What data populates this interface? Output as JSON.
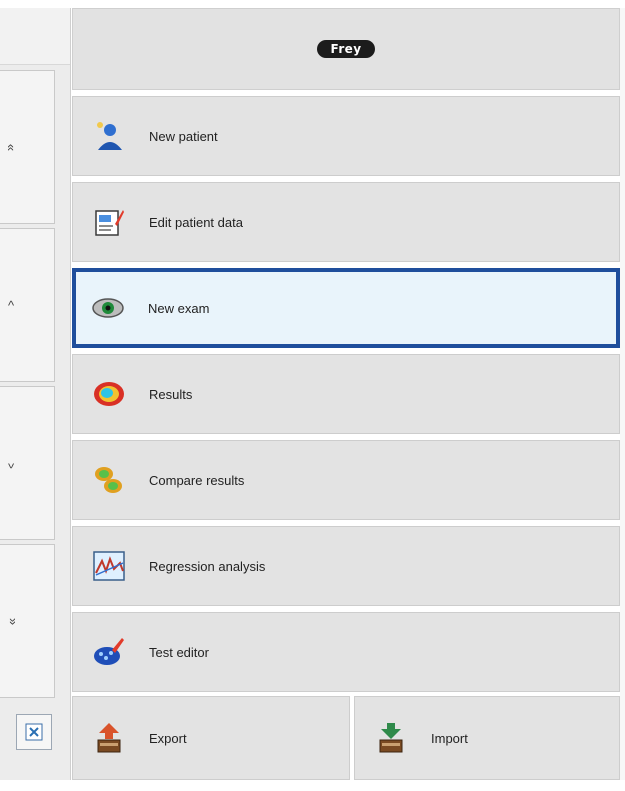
{
  "header": {
    "user": "Frey"
  },
  "left_nav": {
    "buttons": [
      {
        "name": "page-up-double",
        "glyph": "«"
      },
      {
        "name": "page-up",
        "glyph": "^"
      },
      {
        "name": "page-down",
        "glyph": "ˇ"
      },
      {
        "name": "page-down-double",
        "glyph": "»"
      }
    ]
  },
  "menu": {
    "selected_index": 2,
    "items": [
      {
        "label": "New patient",
        "icon": "new-patient-icon"
      },
      {
        "label": "Edit patient data",
        "icon": "edit-patient-icon"
      },
      {
        "label": "New exam",
        "icon": "eye-exam-icon"
      },
      {
        "label": "Results",
        "icon": "results-heatmap-icon"
      },
      {
        "label": "Compare results",
        "icon": "compare-results-icon"
      },
      {
        "label": "Regression analysis",
        "icon": "regression-chart-icon"
      },
      {
        "label": "Test editor",
        "icon": "test-editor-icon"
      }
    ],
    "export_label": "Export",
    "import_label": "Import"
  },
  "colors": {
    "selection_border": "#1f4e9c",
    "selection_bg": "#e9f4fb",
    "button_bg": "#e3e3e3"
  }
}
